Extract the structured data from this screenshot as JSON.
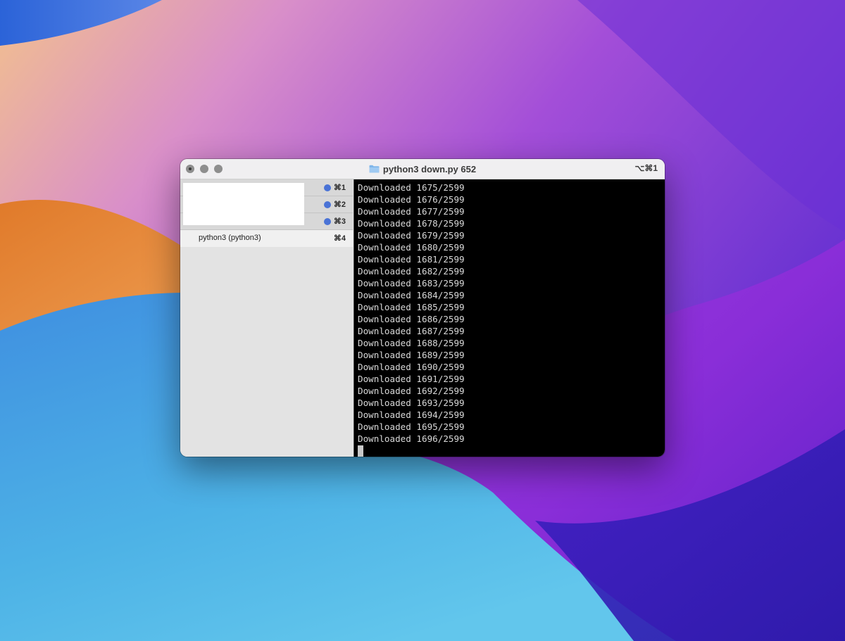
{
  "window": {
    "title": "python3 down.py 652",
    "title_shortcut": "⌥⌘1"
  },
  "sidebar": {
    "sessions": [
      {
        "shortcut": "⌘1",
        "status": "active"
      },
      {
        "shortcut": "⌘2",
        "status": "active"
      },
      {
        "shortcut": "⌘3",
        "status": "active"
      },
      {
        "label": "python3 (python3)",
        "shortcut": "⌘4"
      }
    ]
  },
  "terminal": {
    "lines": [
      "Downloaded 1675/2599",
      "Downloaded 1676/2599",
      "Downloaded 1677/2599",
      "Downloaded 1678/2599",
      "Downloaded 1679/2599",
      "Downloaded 1680/2599",
      "Downloaded 1681/2599",
      "Downloaded 1682/2599",
      "Downloaded 1683/2599",
      "Downloaded 1684/2599",
      "Downloaded 1685/2599",
      "Downloaded 1686/2599",
      "Downloaded 1687/2599",
      "Downloaded 1688/2599",
      "Downloaded 1689/2599",
      "Downloaded 1690/2599",
      "Downloaded 1691/2599",
      "Downloaded 1692/2599",
      "Downloaded 1693/2599",
      "Downloaded 1694/2599",
      "Downloaded 1695/2599",
      "Downloaded 1696/2599"
    ]
  },
  "colors": {
    "session_dot": "#4a73d6",
    "terminal_bg": "#000000",
    "terminal_fg": "#d8d8d8"
  },
  "icons": {
    "title": "folder-icon",
    "session_status": "blue-dot-icon"
  }
}
